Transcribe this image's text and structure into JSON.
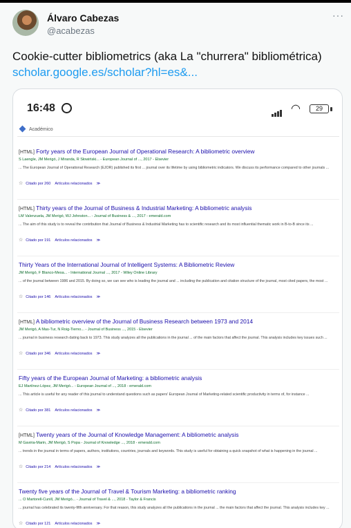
{
  "tweet": {
    "author_name": "Álvaro Cabezas",
    "author_handle": "@acabezas",
    "more_label": "···",
    "text": "Cookie-cutter bibliometrics (aka La \"churrera\" bibliométrica) ",
    "link_text": "scholar.google.es/scholar?hl=es&..."
  },
  "phone": {
    "time": "16:48",
    "battery": "29",
    "section_label": "Académico"
  },
  "results": [
    {
      "tag": "[HTML]",
      "title": "Forty years of the European Journal of Operational Research: A bibliometric overview",
      "meta": "S Laengle, JM Merigó, J Miranda, R Słowiński... - European Journal of ..., 2017 - Elsevier",
      "snippet": "... The European Journal of Operational Research (EJOR) published its first ... journal over its lifetime by using bibliometric indicators. We discuss its performance compared to other journals ...",
      "cited": "Citado por 260",
      "related": "Artículos relacionados",
      "more": "≫"
    },
    {
      "tag": "[HTML]",
      "title": "Thirty years of the Journal of Business & Industrial Marketing: A bibliometric analysis",
      "meta": "LM Valenzuela, JM Merigó, WJ Johnston... - Journal of Business & ..., 2017 - emerald.com",
      "snippet": "... The aim of this study is to reveal the contribution that Journal of Business & Industrial Marketing has to scientific research and its most influential thematic work in B-to-B since its ...",
      "cited": "Citado por 191",
      "related": "Artículos relacionados",
      "more": "≫"
    },
    {
      "tag": "",
      "title": "Thirty Years of the International Journal of Intelligent Systems: A Bibliometric Review",
      "meta": "JM Merigó, F Blanco-Mesa... - International Journal ..., 2017 - Wiley Online Library",
      "snippet": "... of the journal between 1986 and 2015. By doing so, we can see who is leading the journal and ... including the publication and citation structure of the journal, most cited papers, the most ...",
      "cited": "Citado por 146",
      "related": "Artículos relacionados",
      "more": "≫"
    },
    {
      "tag": "[HTML]",
      "title": "A bibliometric overview of the Journal of Business Research between 1973 and 2014",
      "meta": "JM Merigó, A Mas-Tur, N Roig-Tierno... - Journal of Business ..., 2015 - Elsevier",
      "snippet": "... journal in business research dating back to 1973. This study analyzes all the publications in the journal ... of the main factors that affect the journal. This analysis includes key issues such ...",
      "cited": "Citado por 346",
      "related": "Artículos relacionados",
      "more": "≫"
    },
    {
      "tag": "",
      "title": "Fifty years of the European Journal of Marketing: a bibliometric analysis",
      "meta": "EJ Martínez-López, JM Merigó... - European Journal of ..., 2018 - emerald.com",
      "snippet": "... This article is useful for any reader of this journal to understand questions such as papers' European Journal of Marketing-related scientific productivity in terms of, for instance ...",
      "cited": "Citado por 381",
      "related": "Artículos relacionados",
      "more": "≫"
    },
    {
      "tag": "[HTML]",
      "title": "Twenty years of the Journal of Knowledge Management: A bibliometric analysis",
      "meta": "M Gaviria-Marin, JM Merigó, S Popa - Journal of Knowledge ..., 2018 - emerald.com",
      "snippet": "... trends in the journal in terms of papers, authors, institutions, countries, journals and keywords. This study is useful for obtaining a quick snapshot of what is happening in the journal ...",
      "cited": "Citado por 214",
      "related": "Artículos relacionados",
      "more": "≫"
    },
    {
      "tag": "",
      "title": "Twenty five years of the Journal of Travel & Tourism Marketing: a bibliometric ranking",
      "meta": "... O Martorell-Cunill, JM Merigó... - Journal of Travel & ..., 2018 - Taylor & Francis",
      "snippet": "... journal has celebrated its twenty-fifth anniversary. For that reason, this study analyzes all the publications in the journal ... the main factors that affect the journal. This analysis includes key ...",
      "cited": "Citado por 121",
      "related": "Artículos relacionados",
      "more": "≫"
    }
  ],
  "colors": {
    "link": "#1d9bf0",
    "scholar_title": "#1a0dab",
    "scholar_meta": "#0a6a2a"
  }
}
